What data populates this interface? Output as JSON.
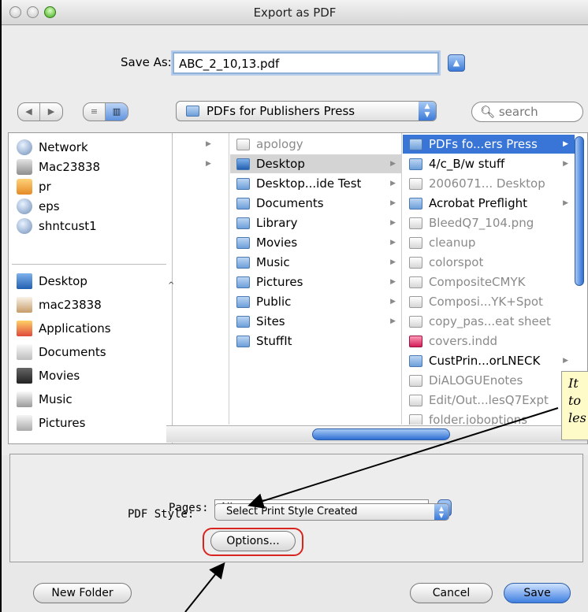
{
  "window": {
    "title": "Export as PDF"
  },
  "save": {
    "label": "Save As:",
    "filename": "ABC_2_10,13.pdf"
  },
  "location": {
    "folder": "PDFs for Publishers Press",
    "search_placeholder": "search"
  },
  "sidebar": {
    "devices": [
      {
        "label": "Network",
        "icon": "network-icon"
      },
      {
        "label": "Mac23838",
        "icon": "hard-disk-icon"
      },
      {
        "label": "pr",
        "icon": "user-volume-icon"
      },
      {
        "label": "eps",
        "icon": "network-volume-icon"
      },
      {
        "label": "shntcust1",
        "icon": "network-volume-icon"
      }
    ],
    "places": [
      {
        "label": "Desktop",
        "icon": "desktop-icon"
      },
      {
        "label": "mac23838",
        "icon": "home-icon"
      },
      {
        "label": "Applications",
        "icon": "applications-icon"
      },
      {
        "label": "Documents",
        "icon": "documents-icon"
      },
      {
        "label": "Movies",
        "icon": "movies-icon"
      },
      {
        "label": "Music",
        "icon": "music-icon"
      },
      {
        "label": "Pictures",
        "icon": "pictures-icon"
      }
    ]
  },
  "columns": {
    "col1": [
      "apology",
      "Desktop",
      "Desktop...ide Test",
      "Documents",
      "Library",
      "Movies",
      "Music",
      "Pictures",
      "Public",
      "Sites",
      "StuffIt"
    ],
    "col2": [
      "PDFs fo...ers Press",
      "4/c_B/w stuff",
      "2006071... Desktop",
      "Acrobat Preflight",
      "BleedQ7_104.png",
      "cleanup",
      "colorspot",
      "CompositeCMYK",
      "Composi...YK+Spot",
      "copy_pas...eat sheet",
      "covers.indd",
      "CustPrin...orLNECK",
      "DiALOGUEnotes",
      "Edit/Out...lesQ7Expt",
      "folder.joboptions"
    ]
  },
  "options": {
    "pages_label": "Pages:",
    "pages_value": "All",
    "style_label": "PDF Style:",
    "style_value": "Select Print Style Created",
    "options_button": "Options..."
  },
  "buttons": {
    "new_folder": "New Folder",
    "cancel": "Cancel",
    "save": "Save"
  },
  "annotation": {
    "text_line1": "It",
    "text_line2": "to",
    "text_line3": "les"
  }
}
